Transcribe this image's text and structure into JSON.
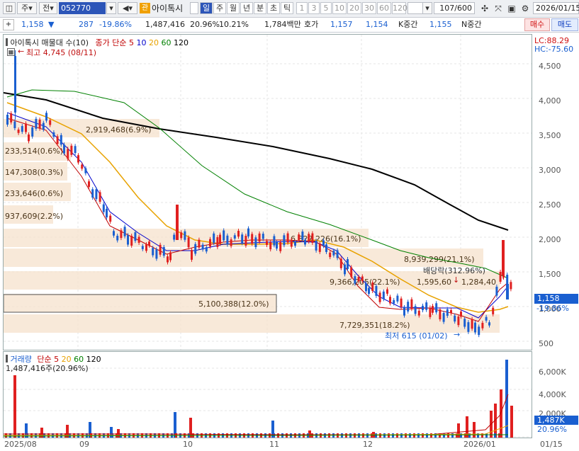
{
  "toolbar": {
    "market_label": "주",
    "type_label": "전",
    "code_value": "052770",
    "stock_badge": "관",
    "stock_name": "아이톡시",
    "periods": [
      "일",
      "주",
      "월",
      "년",
      "분",
      "초",
      "틱"
    ],
    "active_period": "일",
    "intervals": [
      "1",
      "3",
      "5",
      "10",
      "20",
      "30",
      "60",
      "120"
    ],
    "count_value": "107/600",
    "date_value": "2026/01/15"
  },
  "quote": {
    "price": "1,158",
    "arrow": "▼",
    "change": "287",
    "change_pct": "-19.86%",
    "volume": "1,487,416",
    "turnover_pct": "20.96%",
    "ratio": "10.21%",
    "amount": "1,784백만",
    "hoga_label": "호가",
    "ask": "1,157",
    "bid": "1,154",
    "k_label": "K중간",
    "k_value": "1,155",
    "n_label": "N중간",
    "buy_label": "매수",
    "sell_label": "매도"
  },
  "price_chart": {
    "legend_title": "아이톡시 매물대 수(10)",
    "legend_ma_label": "종가 단순",
    "ma_periods": [
      "5",
      "10",
      "20",
      "60",
      "120"
    ],
    "ma_colors": [
      "#c00000",
      "#0000cc",
      "#e8a200",
      "#008000",
      "#000000"
    ],
    "lc_label": "LC:88.29",
    "hc_label": "HC:-75.60",
    "high_label": "최고 4,745 (08/11)",
    "low_label": "최저 615 (01/02)",
    "dividend_label": "배당락(312.96%)",
    "current_price_tag": "1,158",
    "current_pct_tag": "-19.86%",
    "price_ticks": [
      "4,500",
      "4,000",
      "3,500",
      "3,000",
      "2,500",
      "2,000",
      "1,500",
      "1,000",
      "500"
    ],
    "volume_profile": [
      "2,919,468(6.9%)",
      "233,514(0.6%)",
      "147,308(0.3%)",
      "233,646(0.6%)",
      "937,609(2.2%)",
      "6,827,226(16.1%)",
      "8,939,299(21.1%)",
      "9,366,205(22.1%)",
      "1,595,60",
      "1,284,40",
      "5,100,388(12.0%)",
      "7,729,351(18.2%)"
    ],
    "up_color": "#e02020",
    "down_color": "#1a5fd0"
  },
  "volume_chart": {
    "legend_title": "거래량",
    "legend_ma_label": "단순",
    "ma_periods": [
      "5",
      "20",
      "60",
      "120"
    ],
    "volume_text": "1,487,416주(20.96%)",
    "volume_ticks": [
      "6,000K",
      "4,000K",
      "2,000K"
    ],
    "current_tag": "1,487K",
    "current_pct": "20.96%"
  },
  "x_axis": {
    "labels": [
      "2025/08",
      "09",
      "10",
      "11",
      "12",
      "2026/01",
      "01/15"
    ]
  }
}
